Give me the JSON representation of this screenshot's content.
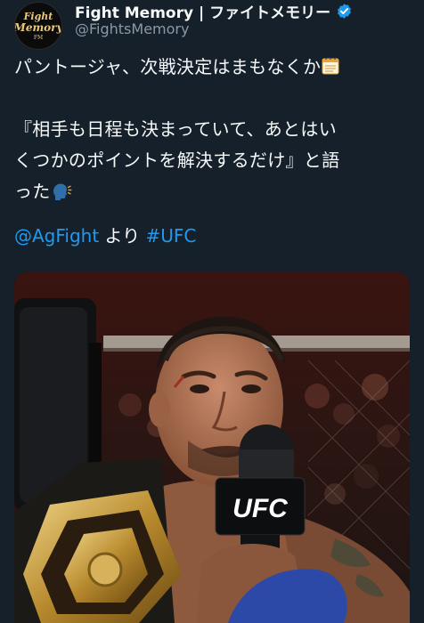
{
  "account": {
    "display_name": "Fight Memory | ファイトメモリー",
    "handle": "@FightsMemory",
    "avatar_text_1": "Fight",
    "avatar_text_2": "Memory",
    "avatar_text_3": "FM"
  },
  "tweet": {
    "line1": "パントージャ、次戦決定はまもなくか",
    "line2": "『相手も日程も決まっていて、あとはい",
    "line3": "くつかのポイントを解決するだけ』と語",
    "line4": "った",
    "mention": "@AgFight",
    "connector": " より ",
    "hashtag": "#UFC"
  },
  "media": {
    "mic_brand": "UFC"
  },
  "colors": {
    "background": "#15202b",
    "link": "#1d9bf0",
    "verified": "#1d9bf0",
    "secondary_text": "#8b98a5"
  },
  "icons": [
    "verified-badge-icon",
    "notepad-emoji-icon",
    "speaking-head-emoji-icon"
  ]
}
